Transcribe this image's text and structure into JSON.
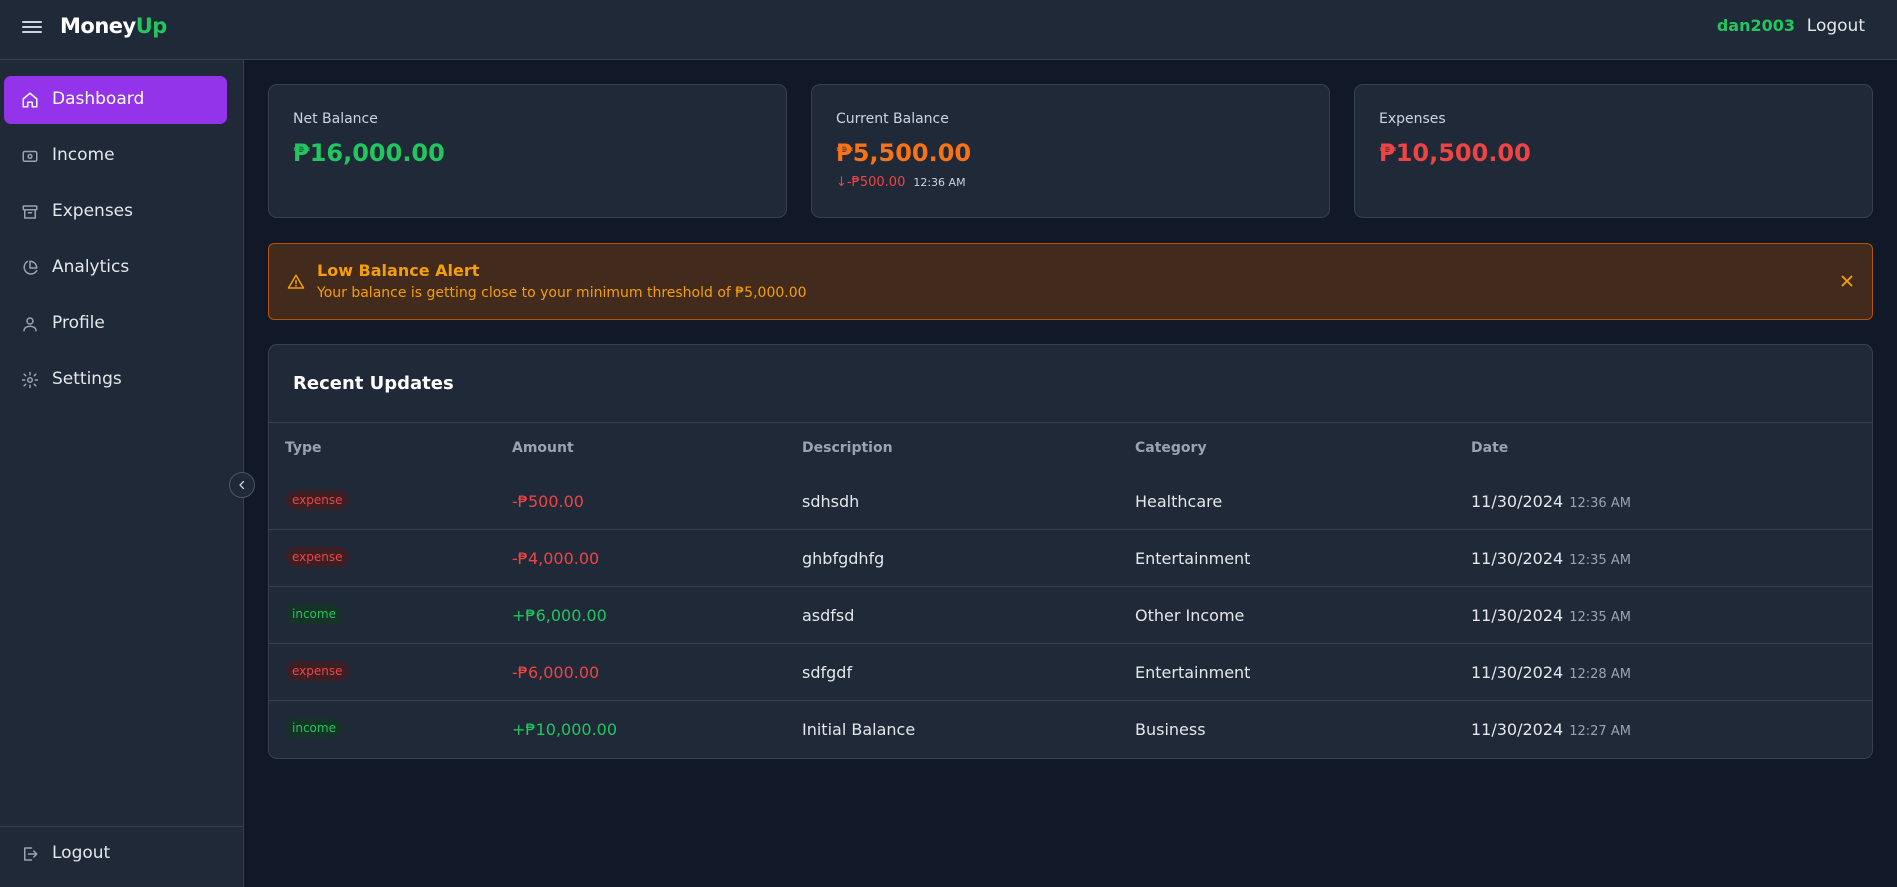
{
  "app": {
    "logo_main": "Money",
    "logo_accent": "Up"
  },
  "header": {
    "username": "dan2003",
    "logout_label": "Logout"
  },
  "sidebar": {
    "items": [
      {
        "label": "Dashboard",
        "icon": "home-icon",
        "active": true
      },
      {
        "label": "Income",
        "icon": "wallet-icon",
        "active": false
      },
      {
        "label": "Expenses",
        "icon": "archive-icon",
        "active": false
      },
      {
        "label": "Analytics",
        "icon": "pie-chart-icon",
        "active": false
      },
      {
        "label": "Profile",
        "icon": "user-icon",
        "active": false
      },
      {
        "label": "Settings",
        "icon": "gear-icon",
        "active": false
      }
    ],
    "logout_label": "Logout"
  },
  "cards": {
    "net": {
      "title": "Net Balance",
      "value": "₱16,000.00",
      "color": "#22c55e"
    },
    "current": {
      "title": "Current Balance",
      "value": "₱5,500.00",
      "color": "#f97316",
      "delta": "↓-₱500.00",
      "time": "12:36 AM"
    },
    "expenses": {
      "title": "Expenses",
      "value": "₱10,500.00",
      "color": "#ef4444"
    }
  },
  "alert": {
    "title": "Low Balance Alert",
    "message": "Your balance is getting close to your minimum threshold of ₱5,000.00"
  },
  "updates": {
    "title": "Recent Updates",
    "headers": {
      "type": "Type",
      "amount": "Amount",
      "description": "Description",
      "category": "Category",
      "date": "Date"
    },
    "rows": [
      {
        "type": "expense",
        "amount": "-₱500.00",
        "description": "sdhsdh",
        "category": "Healthcare",
        "date": "11/30/2024",
        "time": "12:36 AM"
      },
      {
        "type": "expense",
        "amount": "-₱4,000.00",
        "description": "ghbfgdhfg",
        "category": "Entertainment",
        "date": "11/30/2024",
        "time": "12:35 AM"
      },
      {
        "type": "income",
        "amount": "+₱6,000.00",
        "description": "asdfsd",
        "category": "Other Income",
        "date": "11/30/2024",
        "time": "12:35 AM"
      },
      {
        "type": "expense",
        "amount": "-₱6,000.00",
        "description": "sdfgdf",
        "category": "Entertainment",
        "date": "11/30/2024",
        "time": "12:28 AM"
      },
      {
        "type": "income",
        "amount": "+₱10,000.00",
        "description": "Initial Balance",
        "category": "Business",
        "date": "11/30/2024",
        "time": "12:27 AM"
      }
    ]
  }
}
